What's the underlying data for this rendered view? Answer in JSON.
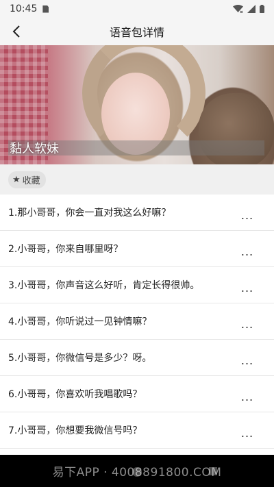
{
  "status_bar": {
    "time": "10:45"
  },
  "header": {
    "title": "语音包详情"
  },
  "hero": {
    "label": "黏人软妹"
  },
  "favorite": {
    "icon": "star-icon",
    "label": "收藏",
    "star": "★"
  },
  "items": [
    {
      "text": "1.那小哥哥，你会一直对我这么好嘛？",
      "more": "..."
    },
    {
      "text": "2.小哥哥，你来自哪里呀？",
      "more": "..."
    },
    {
      "text": "3.小哥哥，你声音这么好听，肯定长得很帅。",
      "more": "..."
    },
    {
      "text": "4.小哥哥，你听说过一见钟情嘛？",
      "more": "..."
    },
    {
      "text": "5.小哥哥，你微信号是多少？呀。",
      "more": "..."
    },
    {
      "text": "6.小哥哥，你喜欢听我唱歌吗？",
      "more": "..."
    },
    {
      "text": "7.小哥哥，你想要我微信号吗？",
      "more": "..."
    }
  ],
  "watermark": "易下APP · 4008891800.COM"
}
